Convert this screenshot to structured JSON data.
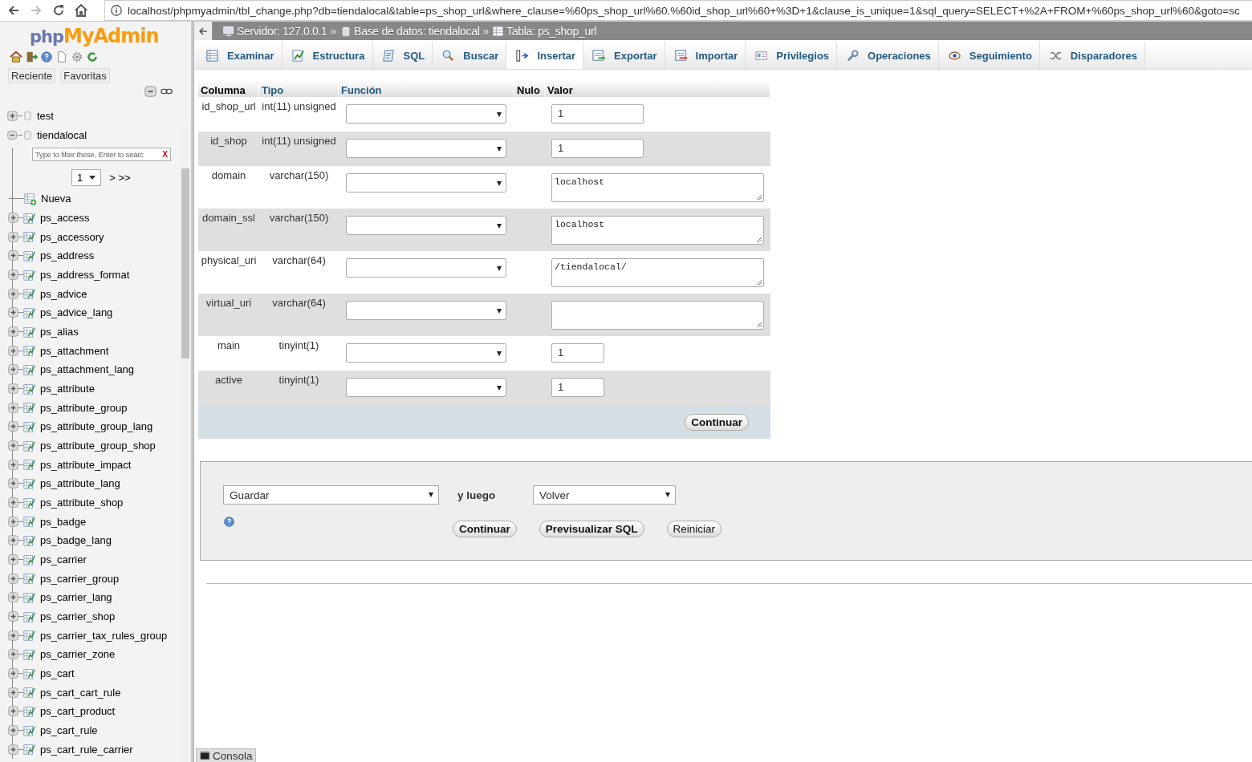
{
  "browser": {
    "url": "localhost/phpmyadmin/tbl_change.php?db=tiendalocal&table=ps_shop_url&where_clause=%60ps_shop_url%60.%60id_shop_url%60+%3D+1&clause_is_unique=1&sql_query=SELECT+%2A+FROM+%60ps_shop_url%60&goto=sc"
  },
  "sidebar": {
    "logo_prefix": "php",
    "logo_main": "MyAdmin",
    "tabs": [
      "Reciente",
      "Favoritas"
    ],
    "tree": [
      {
        "label": "test",
        "expanded": false
      },
      {
        "label": "tiendalocal",
        "expanded": true,
        "filter_placeholder": "Type to filter these, Enter to searc",
        "filter_clear": "X",
        "page": "1",
        "pager": "> >>",
        "children": [
          {
            "label": "Nueva",
            "kind": "new"
          },
          {
            "label": "ps_access",
            "kind": "table"
          },
          {
            "label": "ps_accessory",
            "kind": "table"
          },
          {
            "label": "ps_address",
            "kind": "table"
          },
          {
            "label": "ps_address_format",
            "kind": "table"
          },
          {
            "label": "ps_advice",
            "kind": "table"
          },
          {
            "label": "ps_advice_lang",
            "kind": "table"
          },
          {
            "label": "ps_alias",
            "kind": "table"
          },
          {
            "label": "ps_attachment",
            "kind": "table"
          },
          {
            "label": "ps_attachment_lang",
            "kind": "table"
          },
          {
            "label": "ps_attribute",
            "kind": "table"
          },
          {
            "label": "ps_attribute_group",
            "kind": "table"
          },
          {
            "label": "ps_attribute_group_lang",
            "kind": "table"
          },
          {
            "label": "ps_attribute_group_shop",
            "kind": "table"
          },
          {
            "label": "ps_attribute_impact",
            "kind": "table"
          },
          {
            "label": "ps_attribute_lang",
            "kind": "table"
          },
          {
            "label": "ps_attribute_shop",
            "kind": "table"
          },
          {
            "label": "ps_badge",
            "kind": "table"
          },
          {
            "label": "ps_badge_lang",
            "kind": "table"
          },
          {
            "label": "ps_carrier",
            "kind": "table"
          },
          {
            "label": "ps_carrier_group",
            "kind": "table"
          },
          {
            "label": "ps_carrier_lang",
            "kind": "table"
          },
          {
            "label": "ps_carrier_shop",
            "kind": "table"
          },
          {
            "label": "ps_carrier_tax_rules_group",
            "kind": "table"
          },
          {
            "label": "ps_carrier_zone",
            "kind": "table"
          },
          {
            "label": "ps_cart",
            "kind": "table"
          },
          {
            "label": "ps_cart_cart_rule",
            "kind": "table"
          },
          {
            "label": "ps_cart_product",
            "kind": "table"
          },
          {
            "label": "ps_cart_rule",
            "kind": "table"
          },
          {
            "label": "ps_cart_rule_carrier",
            "kind": "table"
          }
        ]
      }
    ]
  },
  "breadcrumb": [
    {
      "label": "Servidor: 127.0.0.1",
      "kind": "server"
    },
    {
      "label": "»",
      "kind": "separator"
    },
    {
      "label": "Base de datos: tiendalocal",
      "kind": "database"
    },
    {
      "label": "»",
      "kind": "separator"
    },
    {
      "label": "Tabla: ps_shop_url",
      "kind": "table"
    }
  ],
  "tabs": [
    {
      "label": "Examinar",
      "selected": false
    },
    {
      "label": "Estructura",
      "selected": false
    },
    {
      "label": "SQL",
      "selected": false
    },
    {
      "label": "Buscar",
      "selected": false
    },
    {
      "label": "Insertar",
      "selected": true
    },
    {
      "label": "Exportar",
      "selected": false
    },
    {
      "label": "Importar",
      "selected": false
    },
    {
      "label": "Privilegios",
      "selected": false
    },
    {
      "label": "Operaciones",
      "selected": false
    },
    {
      "label": "Seguimiento",
      "selected": false
    },
    {
      "label": "Disparadores",
      "selected": false
    }
  ],
  "form": {
    "headers": [
      {
        "label": "Columna",
        "link": false
      },
      {
        "label": "Tipo",
        "link": true
      },
      {
        "label": "Función",
        "link": true
      },
      {
        "label": "Nulo",
        "link": false
      },
      {
        "label": "Valor",
        "link": false
      }
    ],
    "rows": [
      {
        "column": "id_shop_url",
        "type": "int(11) unsigned",
        "kind": "input",
        "value": "1"
      },
      {
        "column": "id_shop",
        "type": "int(11) unsigned",
        "kind": "input",
        "value": "1"
      },
      {
        "column": "domain",
        "type": "varchar(150)",
        "kind": "textarea",
        "value": "localhost"
      },
      {
        "column": "domain_ssl",
        "type": "varchar(150)",
        "kind": "textarea",
        "value": "localhost"
      },
      {
        "column": "physical_uri",
        "type": "varchar(64)",
        "kind": "textarea",
        "value": "/tiendalocal/"
      },
      {
        "column": "virtual_uri",
        "type": "varchar(64)",
        "kind": "textarea"
      },
      {
        "column": "main",
        "type": "tinyint(1)",
        "kind": "short-input",
        "value": "1"
      },
      {
        "column": "active",
        "type": "tinyint(1)",
        "kind": "short-input",
        "value": "1"
      }
    ],
    "submit": "Continuar"
  },
  "actions": {
    "action": "Guardar",
    "then_label": "y luego",
    "after": "Volver",
    "buttons": [
      {
        "label": "Continuar",
        "kind": "primary"
      },
      {
        "label": "Previsualizar SQL",
        "kind": "primary"
      },
      {
        "label": "Reiniciar",
        "kind": "plain"
      }
    ]
  },
  "console": "Consola"
}
